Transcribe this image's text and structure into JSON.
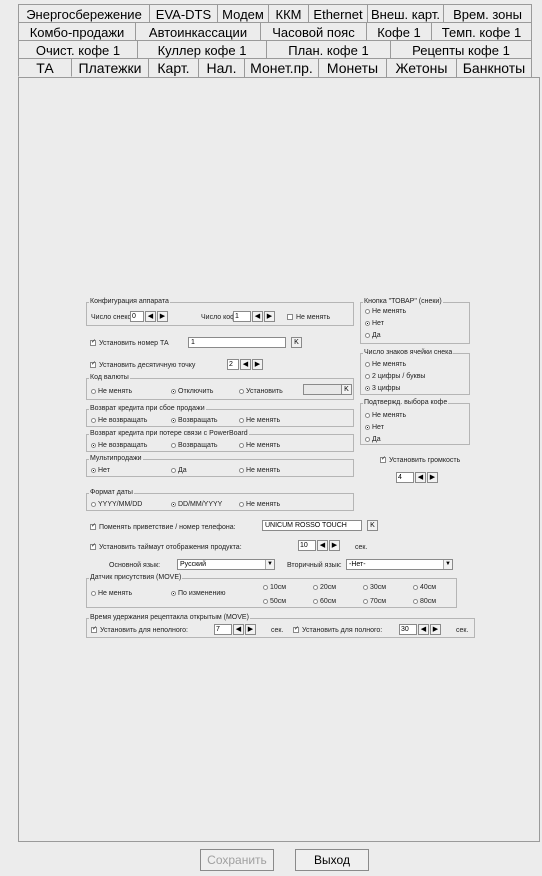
{
  "tabs": {
    "row1": [
      "Энергосбережение",
      "EVA-DTS",
      "Модем",
      "ККМ",
      "Ethernet",
      "Внеш. карт.",
      "Врем. зоны"
    ],
    "row2": [
      "Комбо-продажи",
      "Автоинкассации",
      "Часовой пояс",
      "Кофе 1",
      "Темп. кофе 1"
    ],
    "row3": [
      "Очист. кофе 1",
      "Куллер кофе 1",
      "План. кофе 1",
      "Рецепты кофе 1"
    ],
    "row4": [
      "ТА",
      "Платежки",
      "Карт.",
      "Нал.",
      "Монет.пр.",
      "Монеты",
      "Жетоны",
      "Банкноты"
    ]
  },
  "config": {
    "title": "Конфигурация аппарата",
    "snacks_label": "Число снеков:",
    "snacks_value": "0",
    "coffee_label": "Число кофе:",
    "coffee_value": "1",
    "no_change": "Не менять"
  },
  "ta_number": {
    "label": "Установить номер ТА",
    "value": "1",
    "kbtn": "K"
  },
  "decimal": {
    "label": "Установить десятичную точку",
    "value": "2"
  },
  "currency": {
    "title": "Код валюты",
    "opt1": "Не менять",
    "opt2": "Отключить",
    "opt3": "Установить",
    "kbtn": "K"
  },
  "refund_fail": {
    "title": "Возврат кредита при сбое продажи",
    "opt1": "Не возвращать",
    "opt2": "Возвращать",
    "opt3": "Не менять"
  },
  "refund_link": {
    "title": "Возврат кредита при потере связи с PowerBoard",
    "opt1": "Не возвращать",
    "opt2": "Возвращать",
    "opt3": "Не менять"
  },
  "multi": {
    "title": "Мультипродажи",
    "opt1": "Нет",
    "opt2": "Да",
    "opt3": "Не менять"
  },
  "datefmt": {
    "title": "Формат даты",
    "opt1": "YYYY/MM/DD",
    "opt2": "DD/MM/YYYY",
    "opt3": "Не менять"
  },
  "greeting": {
    "label": "Поменять приветствие / номер телефона:",
    "value": "UNICUM ROSSO TOUCH",
    "kbtn": "K"
  },
  "timeout": {
    "label": "Установить таймаут отображения продукта:",
    "value": "10",
    "unit": "сек."
  },
  "lang": {
    "main_label": "Основной язык:",
    "main_value": "Русский",
    "second_label": "Вторичный язык:",
    "second_value": "-Нет-"
  },
  "sensor": {
    "title": "Датчик присутствия (MOVE)",
    "opt1": "Не менять",
    "opt2": "По изменению",
    "d": [
      "10см",
      "20см",
      "30см",
      "40см",
      "50см",
      "60см",
      "70см",
      "80см"
    ]
  },
  "hold": {
    "title": "Время удержания рецептакла открытым (MOVE)",
    "partial_label": "Установить для неполного:",
    "partial_value": "7",
    "unit": "сек.",
    "full_label": "Установить для полного:",
    "full_value": "30",
    "unit2": "сек."
  },
  "goods_btn": {
    "title": "Кнопка \"ТОВАР\" (снеки)",
    "opt1": "Не менять",
    "opt2": "Нет",
    "opt3": "Да"
  },
  "cell_chars": {
    "title": "Число знаков ячейки снека",
    "opt1": "Не менять",
    "opt2": "2 цифры / буквы",
    "opt3": "3 цифры"
  },
  "coffee_confirm": {
    "title": "Подтвержд. выбора кофе",
    "opt1": "Не менять",
    "opt2": "Нет",
    "opt3": "Да"
  },
  "volume": {
    "label": "Установить громкость",
    "value": "4"
  },
  "buttons": {
    "save": "Сохранить",
    "exit": "Выход"
  },
  "arrows": {
    "left": "◀",
    "right": "▶",
    "down": "▼"
  }
}
